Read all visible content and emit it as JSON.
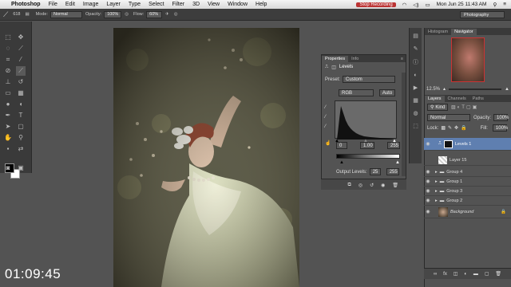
{
  "menubar": {
    "app_name": "Photoshop",
    "items": [
      "File",
      "Edit",
      "Image",
      "Layer",
      "Type",
      "Select",
      "Filter",
      "3D",
      "View",
      "Window",
      "Help"
    ],
    "record_label": "Stop Recording",
    "clock": "Mon Jun 25  11:43 AM"
  },
  "options_bar": {
    "mode_label": "Mode:",
    "mode_value": "Normal",
    "opacity_label": "Opacity:",
    "opacity_value": "100%",
    "flow_label": "Flow:",
    "flow_value": "60%",
    "brush_size": "618",
    "workspace": "Photography"
  },
  "properties": {
    "tabs": [
      "Properties",
      "Info"
    ],
    "adjustment": "Levels",
    "preset_label": "Preset:",
    "preset_value": "Custom",
    "channel": "RGB",
    "auto_label": "Auto",
    "input_levels": [
      "0",
      "1.00",
      "255"
    ],
    "output_label": "Output Levels:",
    "output_levels": [
      "25",
      "255"
    ]
  },
  "navigator": {
    "tabs": [
      "Histogram",
      "Navigator"
    ],
    "zoom": "12.5%"
  },
  "layers_panel": {
    "tabs": [
      "Layers",
      "Channels",
      "Paths"
    ],
    "kind_label": "Kind",
    "blend_mode": "Normal",
    "opacity_label": "Opacity:",
    "opacity_value": "100%",
    "lock_label": "Lock:",
    "fill_label": "Fill:",
    "fill_value": "100%",
    "layers": [
      {
        "name": "Levels 1"
      },
      {
        "name": "Layer 15"
      },
      {
        "name": "Group 4"
      },
      {
        "name": "Group 1"
      },
      {
        "name": "Group 3"
      },
      {
        "name": "Group 2"
      },
      {
        "name": "Background"
      }
    ]
  },
  "timecode": "01:09:45"
}
